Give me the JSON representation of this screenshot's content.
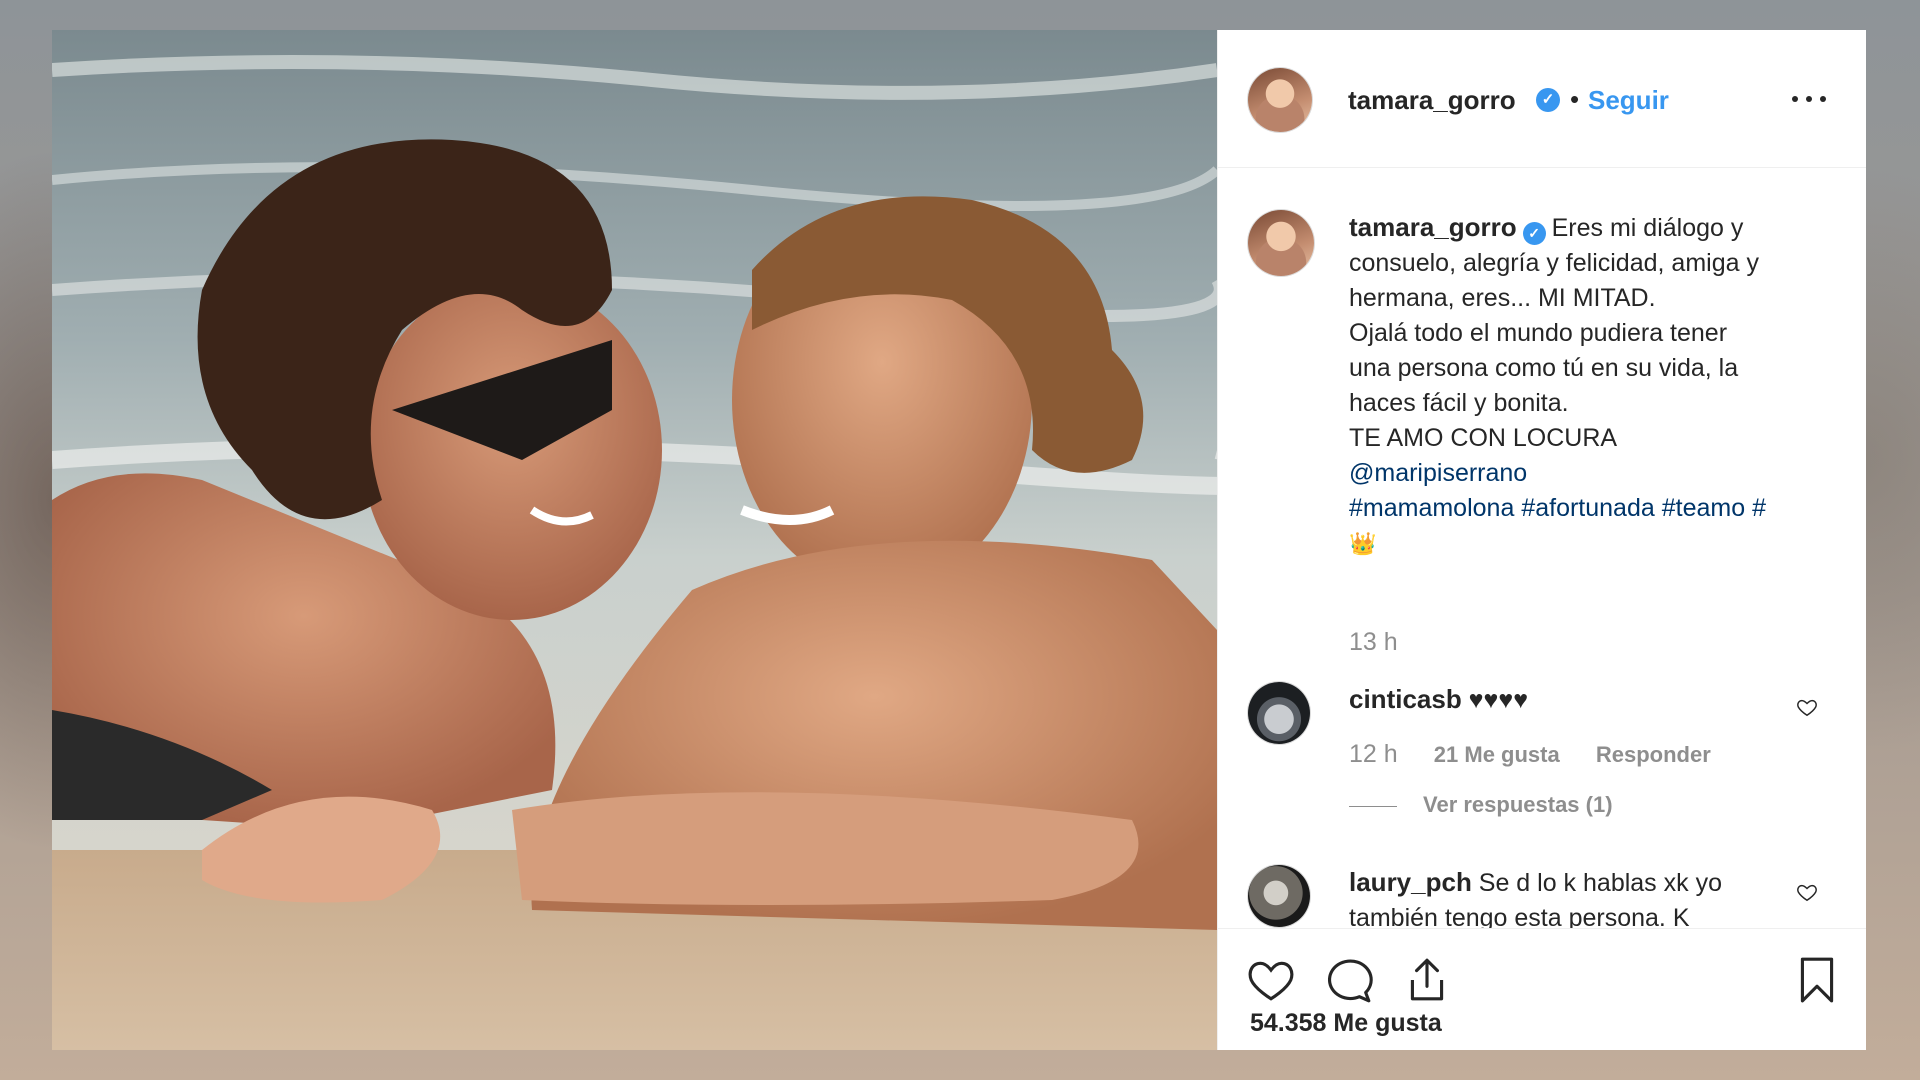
{
  "post": {
    "username": "tamara_gorro",
    "verified": true,
    "follow_label": "Seguir",
    "more_icon": "more-options-icon"
  },
  "caption": {
    "username": "tamara_gorro",
    "lines": [
      "Eres mi diálogo y",
      "consuelo, alegría y felicidad, amiga y",
      "hermana, eres... MI MITAD.",
      "Ojalá todo el mundo pudiera tener",
      "una persona como tú en su vida, la",
      "haces fácil y bonita.",
      "TE AMO CON LOCURA"
    ],
    "mention": "@maripiserrano",
    "hashtags": [
      "#mamamolona",
      "#afortunada",
      "#teamo",
      "#"
    ],
    "emoji": "👑",
    "time": "13 h"
  },
  "comments": [
    {
      "username": "cinticasb",
      "text": "♥♥♥♥",
      "time": "12 h",
      "likes": "21 Me gusta",
      "reply_label": "Responder",
      "view_replies": "Ver respuestas (1)"
    },
    {
      "username": "laury_pch",
      "text_line1": "Se d lo k hablas xk yo",
      "text_line2": "también tengo esta persona. K"
    }
  ],
  "actions": {
    "like_icon": "heart-icon",
    "comment_icon": "comment-icon",
    "share_icon": "share-icon",
    "save_icon": "bookmark-icon",
    "likes_count": "54.358 Me gusta"
  },
  "colors": {
    "link": "#3897f0",
    "text": "#262626",
    "muted": "#8e8e8e",
    "hashtag": "#003569"
  }
}
